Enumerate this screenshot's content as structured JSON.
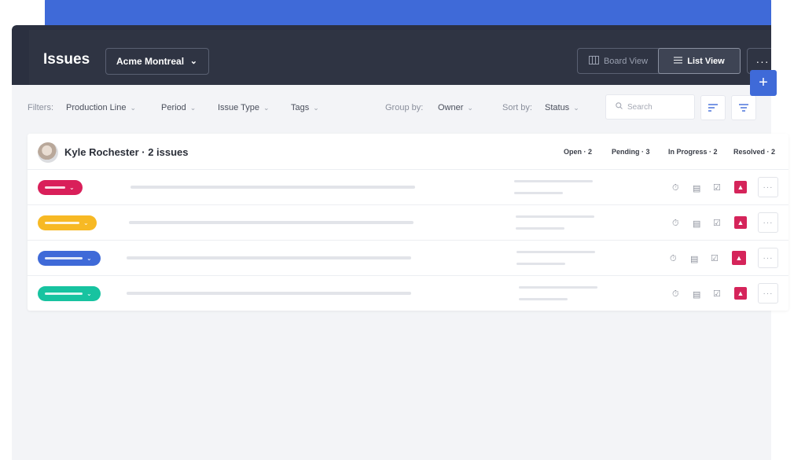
{
  "colors": {
    "accent": "#3f6ad8",
    "header_bg": "#2f3443",
    "priority": "#d5245a"
  },
  "header": {
    "title": "Issues",
    "project": "Acme Montreal",
    "views": {
      "board": "Board View",
      "list": "List View"
    },
    "more": "···"
  },
  "filters": {
    "label": "Filters:",
    "items": [
      "Production Line",
      "Period",
      "Issue Type",
      "Tags"
    ],
    "group_by_label": "Group by:",
    "group_by_value": "Owner",
    "sort_by_label": "Sort by:",
    "sort_by_value": "Status",
    "search_placeholder": "Search"
  },
  "group": {
    "owner": "Kyle Rochester · 2 issues",
    "stats": [
      "Open · 2",
      "Pending · 3",
      "In Progress · 2",
      "Resolved · 2"
    ]
  },
  "rows": [
    {
      "status_color": "#d91f5a",
      "icon_timer": "timer-icon"
    },
    {
      "status_color": "#f7b924",
      "icon_timer": "timer-icon"
    },
    {
      "status_color": "#3f6ad8",
      "icon_timer": "timer-icon"
    },
    {
      "status_color": "#17c3a0",
      "icon_timer": "timer-icon"
    }
  ]
}
